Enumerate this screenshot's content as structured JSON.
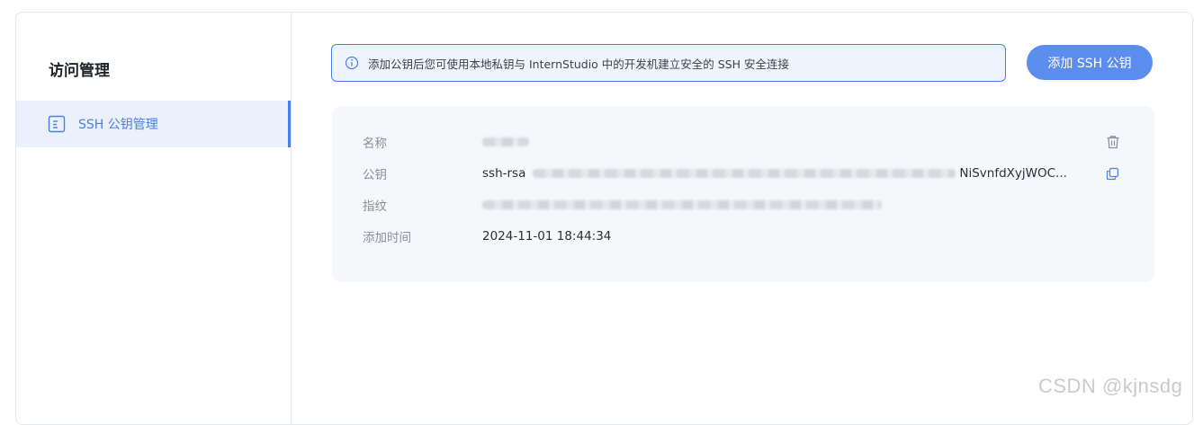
{
  "sidebar": {
    "title": "访问管理",
    "items": [
      {
        "label": "SSH 公钥管理",
        "icon": "document-list-icon",
        "active": true
      }
    ]
  },
  "notice": {
    "icon": "info-circle-icon",
    "text": "添加公钥后您可使用本地私钥与 InternStudio 中的开发机建立安全的 SSH 安全连接"
  },
  "toolbar": {
    "add_label": "添加 SSH 公钥"
  },
  "key_card": {
    "name_label": "名称",
    "key_label": "公钥",
    "key_prefix": "ssh-rsa",
    "key_visible_tail": "NiSvnfdXyjWOC...",
    "fingerprint_label": "指纹",
    "added_time_label": "添加时间",
    "added_time": "2024-11-01 18:44:34"
  },
  "watermark": "CSDN @kjnsdg",
  "colors": {
    "accent": "#4b7fe5",
    "button": "#5b8def",
    "notice_bg": "#eef4fe",
    "card_bg": "#f5f7fa"
  }
}
